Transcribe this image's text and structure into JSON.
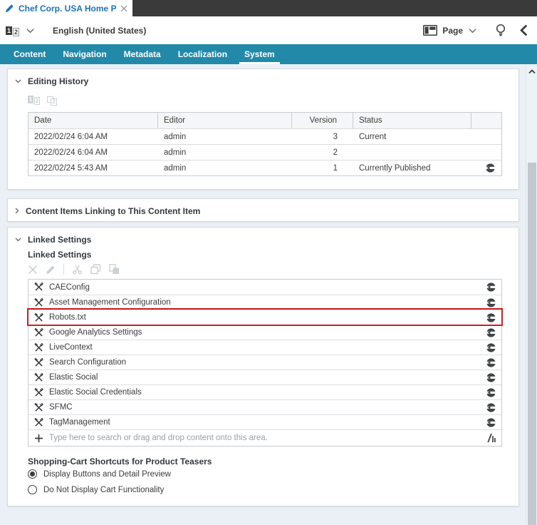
{
  "titlebar": {
    "document_title": "Chef Corp. USA Home P…"
  },
  "toolbar": {
    "locale_icon_digits": [
      "1",
      "2"
    ],
    "locale_label": "English (United States)",
    "view_label": "Page"
  },
  "tabs": {
    "items": [
      "Content",
      "Navigation",
      "Metadata",
      "Localization",
      "System"
    ],
    "active": "System"
  },
  "editing_history": {
    "title": "Editing History",
    "columns": [
      "Date",
      "Editor",
      "Version",
      "Status"
    ],
    "rows": [
      {
        "date": "2022/02/24 6:04 AM",
        "editor": "admin",
        "version": "3",
        "status": "Current"
      },
      {
        "date": "2022/02/24 6:04 AM",
        "editor": "admin",
        "version": "2",
        "status": ""
      },
      {
        "date": "2022/02/24 5:43 AM",
        "editor": "admin",
        "version": "1",
        "status": "Currently Published"
      }
    ]
  },
  "linking_section": {
    "title": "Content Items Linking to This Content Item"
  },
  "linked_settings": {
    "section_title": "Linked Settings",
    "field_label": "Linked Settings",
    "items": [
      "CAEConfig",
      "Asset Management Configuration",
      "Robots.txt",
      "Google Analytics Settings",
      "LiveContext",
      "Search Configuration",
      "Elastic Social",
      "Elastic Social Credentials",
      "SFMC",
      "TagManagement"
    ],
    "highlighted_item": "Robots.txt",
    "search_placeholder": "Type here to search or drag and drop content onto this area."
  },
  "shopping_cart": {
    "label": "Shopping-Cart Shortcuts for Product Teasers",
    "options": [
      "Display Buttons and Detail Preview",
      "Do Not Display Cart Functionality"
    ],
    "selected": "Display Buttons and Detail Preview"
  },
  "colors": {
    "accent_teal": "#2289a8",
    "doc_tab_blue": "#1d72b8",
    "highlight_red": "#ce1e1e"
  }
}
